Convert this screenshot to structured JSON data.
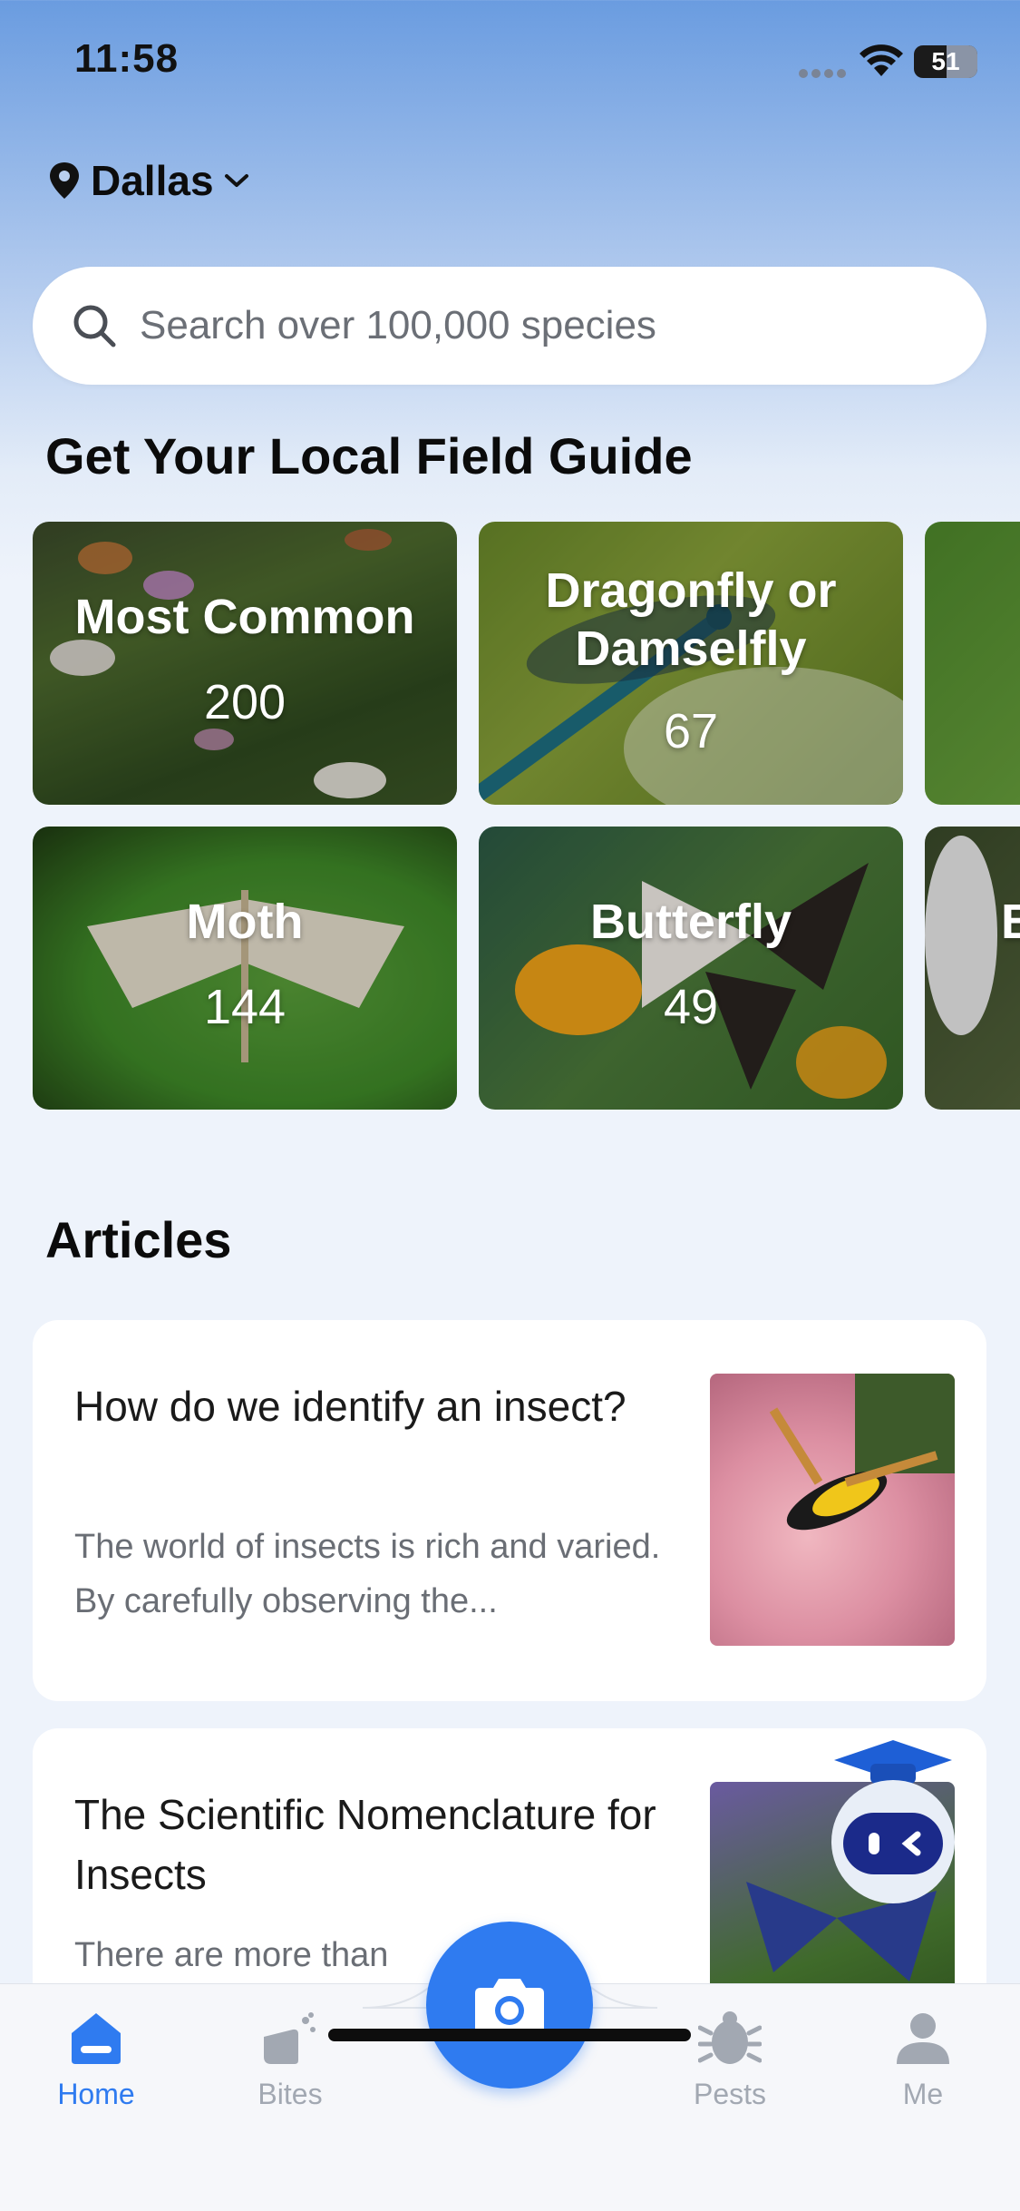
{
  "status": {
    "time": "11:58",
    "battery": "51",
    "battery_level": 0.51
  },
  "location": {
    "city": "Dallas"
  },
  "search": {
    "placeholder": "Search over 100,000 species"
  },
  "field_guide": {
    "heading": "Get Your Local Field Guide",
    "cards": [
      {
        "title": "Most Common",
        "count": "200"
      },
      {
        "title": "Dragonfly or Damselfly",
        "count": "67"
      },
      {
        "title": "Moth",
        "count": "144"
      },
      {
        "title": "Butterfly",
        "count": "49"
      },
      {
        "title": "B",
        "count": ""
      }
    ]
  },
  "articles": {
    "heading": "Articles",
    "items": [
      {
        "title": "How do we identify an insect?",
        "desc": "The world of insects is rich and varied. By carefully observing the..."
      },
      {
        "title": "The Scientific Nomenclature for Insects",
        "desc": "There are more than"
      }
    ]
  },
  "tabs": [
    {
      "label": "Home",
      "icon": "home-icon",
      "active": true
    },
    {
      "label": "Bites",
      "icon": "hand-icon",
      "active": false
    },
    {
      "label": "Pests",
      "icon": "bug-icon",
      "active": false
    },
    {
      "label": "Me",
      "icon": "person-icon",
      "active": false
    }
  ],
  "colors": {
    "accent": "#2f7bf0",
    "inactive": "#a2a8b2"
  }
}
